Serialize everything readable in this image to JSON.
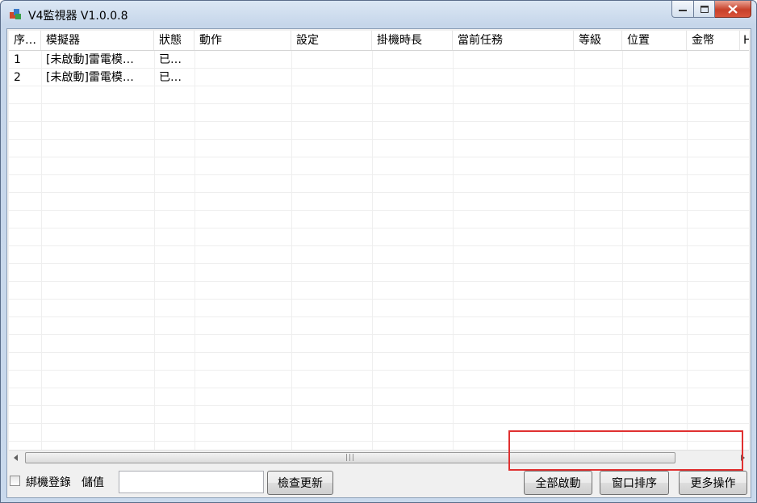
{
  "window": {
    "title": "V4監視器 V1.0.0.8"
  },
  "table": {
    "columns": [
      "序…",
      "模擬器",
      "狀態",
      "動作",
      "設定",
      "掛機時長",
      "當前任務",
      "等級",
      "位置",
      "金幣",
      "H"
    ],
    "rows": [
      [
        "1",
        "[未啟動]雷電模…",
        "已…",
        "",
        "",
        "",
        "",
        "",
        "",
        "",
        ""
      ],
      [
        "2",
        "[未啟動]雷電模…",
        "已…",
        "",
        "",
        "",
        "",
        "",
        "",
        "",
        ""
      ]
    ]
  },
  "bottom": {
    "bind_login_label": "綁機登錄",
    "bind_login_checked": false,
    "recharge_label": "儲值",
    "recharge_value": "",
    "check_update_label": "檢查更新",
    "start_all_label": "全部啟動",
    "arrange_windows_label": "窗口排序",
    "more_actions_label": "更多操作"
  },
  "colors": {
    "highlight": "#e03030",
    "close_button": "#c7412a"
  }
}
